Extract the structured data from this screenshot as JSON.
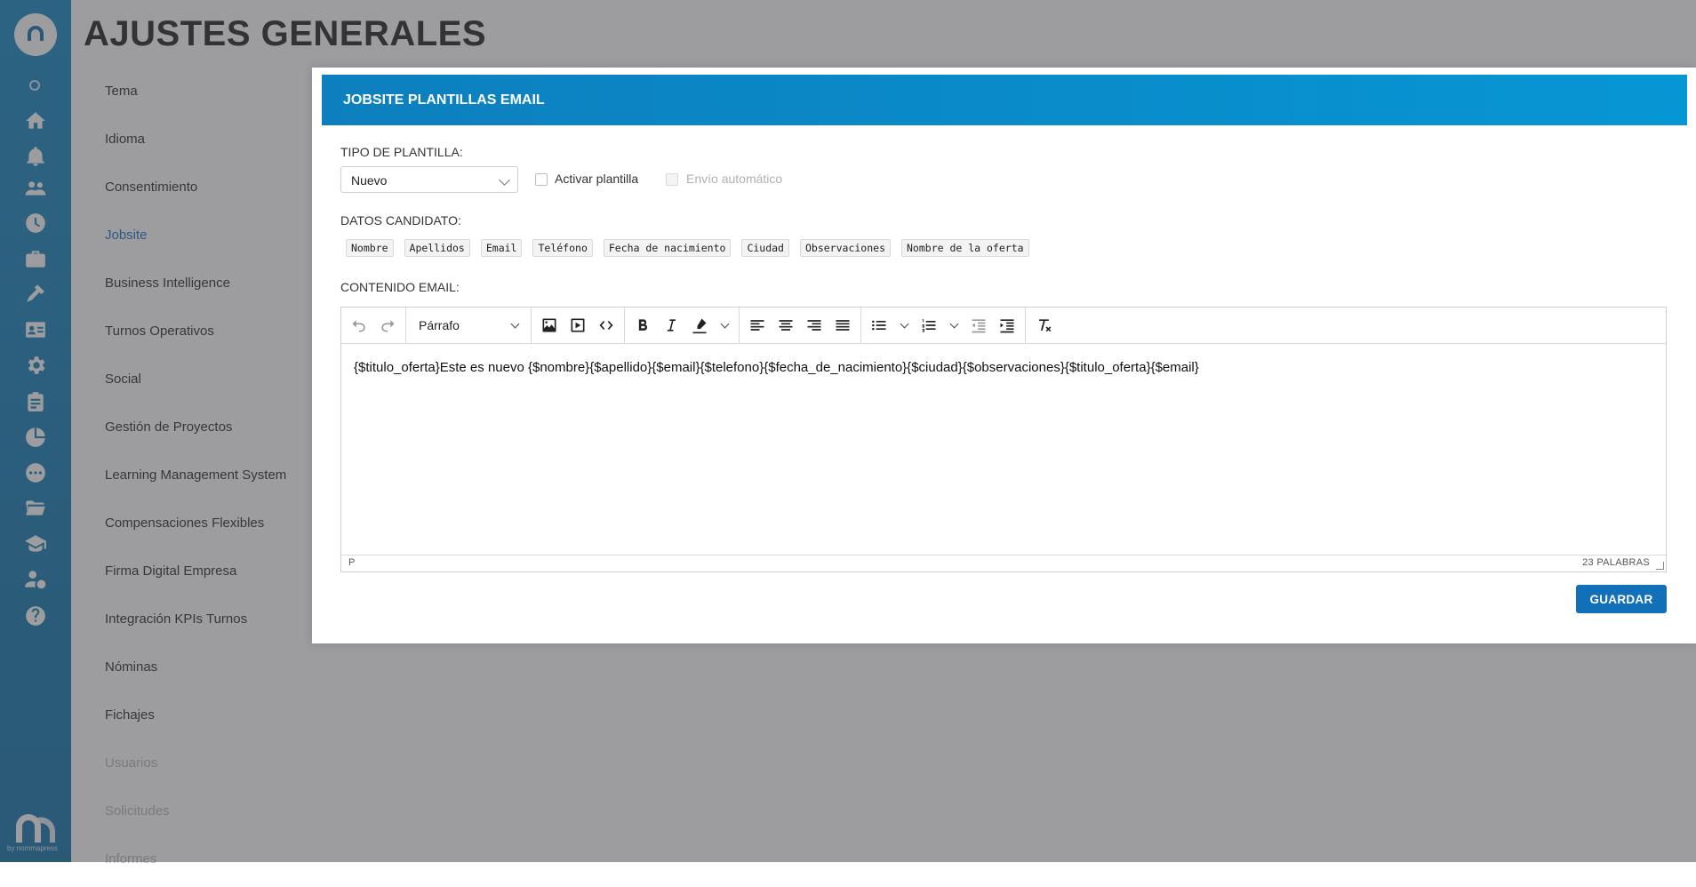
{
  "page": {
    "title": "AJUSTES GENERALES"
  },
  "sidebar_menu": {
    "items": [
      {
        "label": "Tema"
      },
      {
        "label": "Idioma"
      },
      {
        "label": "Consentimiento"
      },
      {
        "label": "Jobsite"
      },
      {
        "label": "Business Intelligence"
      },
      {
        "label": "Turnos Operativos"
      },
      {
        "label": "Social"
      },
      {
        "label": "Gestión de Proyectos"
      },
      {
        "label": "Learning Management System"
      },
      {
        "label": "Compensaciones Flexibles"
      },
      {
        "label": "Firma Digital Empresa"
      },
      {
        "label": "Integración KPIs Turnos"
      },
      {
        "label": "Nóminas"
      },
      {
        "label": "Fichajes"
      },
      {
        "label": "Usuarios"
      },
      {
        "label": "Solicitudes"
      },
      {
        "label": "Informes"
      }
    ],
    "active": "Jobsite"
  },
  "rail": {
    "icons": [
      "home-icon",
      "bell-icon",
      "users-icon",
      "clock-icon",
      "briefcase-icon",
      "tools-icon",
      "id-card-icon",
      "gear-icon",
      "clipboard-icon",
      "pie-chart-icon",
      "chat-icon",
      "folder-icon",
      "graduation-cap-icon",
      "user-money-icon",
      "help-icon"
    ],
    "brand_caption": "by nommapress"
  },
  "modal": {
    "title": "JOBSITE PLANTILLAS EMAIL",
    "template_type_label": "TIPO DE PLANTILLA:",
    "template_type_value": "Nuevo",
    "activate_label": "Activar plantilla",
    "auto_send_label": "Envío automático",
    "candidate_data_label": "DATOS CANDIDATO:",
    "candidate_chips": [
      "Nombre",
      "Apellidos",
      "Email",
      "Teléfono",
      "Fecha de nacimiento",
      "Ciudad",
      "Observaciones",
      "Nombre de la oferta"
    ],
    "email_content_label": "CONTENIDO EMAIL:",
    "editor": {
      "block_format": "Párrafo",
      "content": "{$titulo_oferta}Este es nuevo {$nombre}{$apellido}{$email}{$telefono}{$fecha_de_nacimiento}{$ciudad}{$observaciones}{$titulo_oferta}{$email}",
      "status_path": "P",
      "word_count": "23 PALABRAS"
    },
    "save_label": "GUARDAR"
  },
  "colors": {
    "brand": "#1877ab",
    "accent": "#1170b8",
    "header": "#0796d4"
  }
}
